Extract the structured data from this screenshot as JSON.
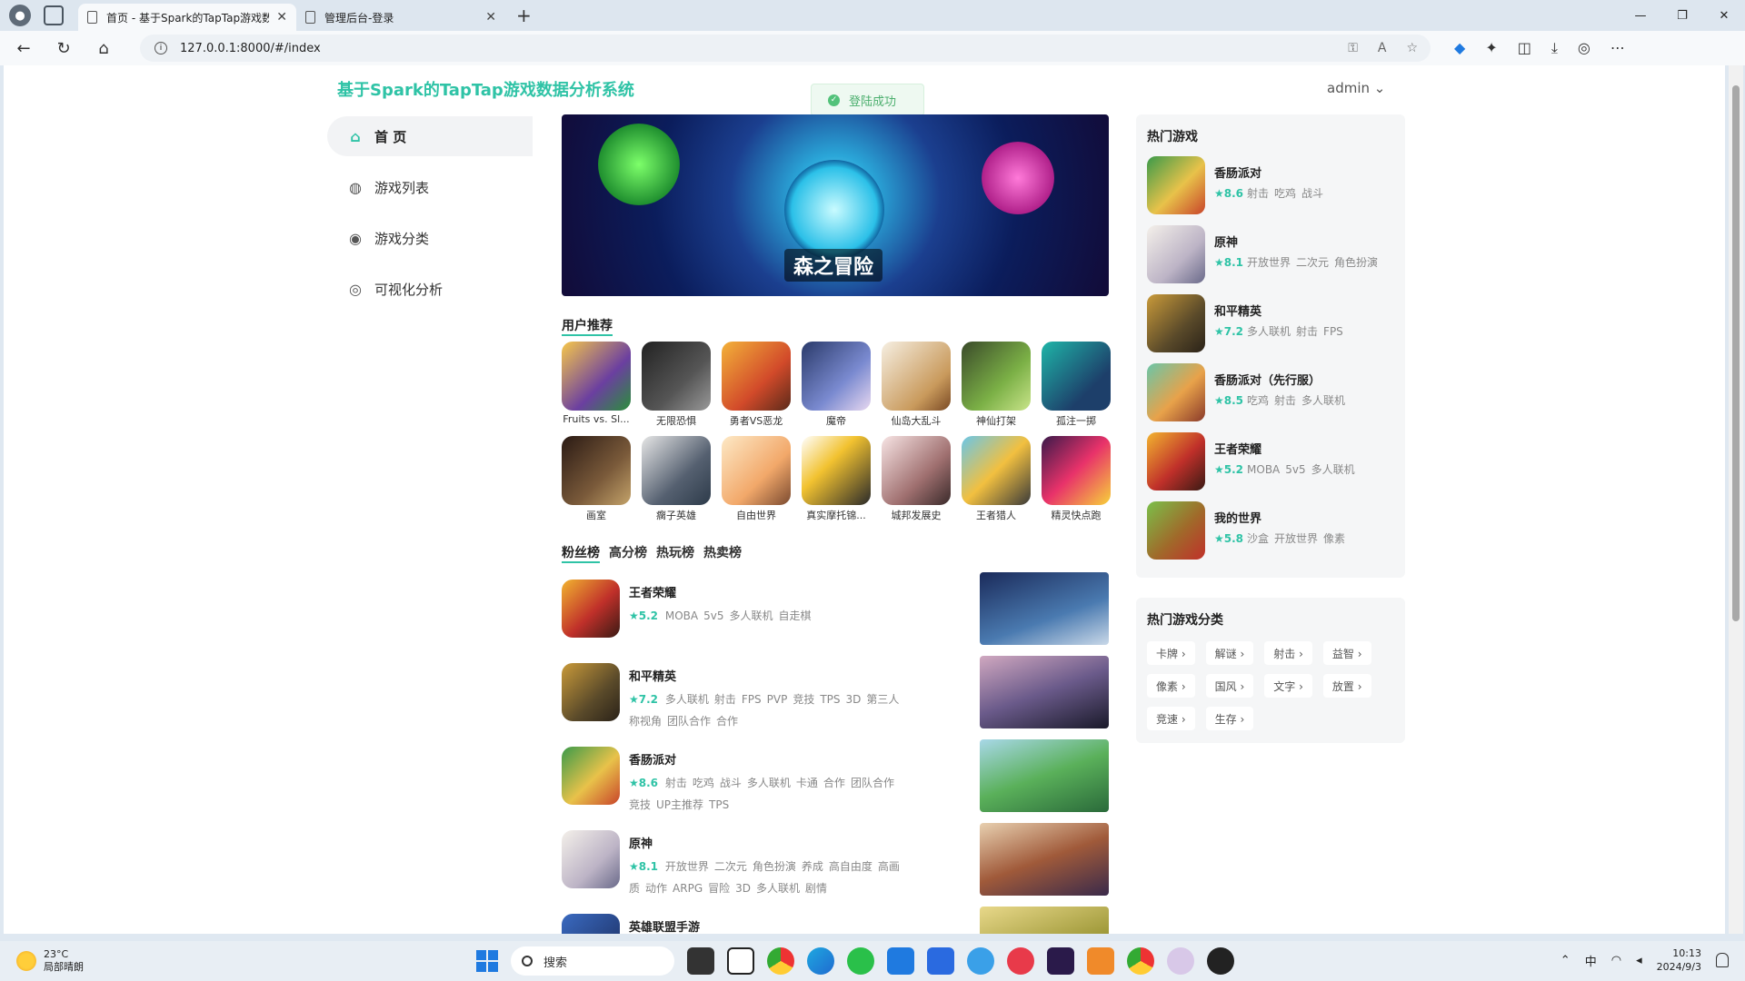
{
  "browser": {
    "tabs": [
      {
        "title": "首页 - 基于Spark的TapTap游戏数",
        "active": true
      },
      {
        "title": "管理后台-登录",
        "active": false
      }
    ],
    "url": "127.0.0.1:8000/#/index"
  },
  "site": {
    "title": "基于Spark的TapTap游戏数据分析系统",
    "user": "admin",
    "toast": "登陆成功"
  },
  "sidebar": {
    "items": [
      {
        "label": "首 页",
        "icon": "home-icon",
        "active": true
      },
      {
        "label": "游戏列表",
        "icon": "planet-icon",
        "active": false
      },
      {
        "label": "游戏分类",
        "icon": "gamepad-icon",
        "active": false
      },
      {
        "label": "可视化分析",
        "icon": "analytics-icon",
        "active": false
      }
    ]
  },
  "banner": {
    "caption": "森之冒险"
  },
  "recommend": {
    "title": "用户推荐",
    "row1": [
      {
        "name": "Fruits vs. Sl..."
      },
      {
        "name": "无限恐惧"
      },
      {
        "name": "勇者VS恶龙"
      },
      {
        "name": "魔帝"
      },
      {
        "name": "仙岛大乱斗"
      },
      {
        "name": "神仙打架"
      },
      {
        "name": "孤注一掷"
      }
    ],
    "row2": [
      {
        "name": "画室"
      },
      {
        "name": "瘸子英雄"
      },
      {
        "name": "自由世界"
      },
      {
        "name": "真实摩托锦..."
      },
      {
        "name": "城邦发展史"
      },
      {
        "name": "王者猎人"
      },
      {
        "name": "精灵快点跑"
      }
    ]
  },
  "rank": {
    "tabs": [
      "粉丝榜",
      "高分榜",
      "热玩榜",
      "热卖榜"
    ],
    "active_tab": "粉丝榜",
    "items": [
      {
        "name": "王者荣耀",
        "score": "★5.2",
        "tags": [
          "MOBA",
          "5v5",
          "多人联机",
          "自走棋"
        ]
      },
      {
        "name": "和平精英",
        "score": "★7.2",
        "tags": [
          "多人联机",
          "射击",
          "FPS",
          "PVP",
          "竞技",
          "TPS",
          "3D",
          "第三人称视角",
          "团队合作",
          "合作"
        ]
      },
      {
        "name": "香肠派对",
        "score": "★8.6",
        "tags": [
          "射击",
          "吃鸡",
          "战斗",
          "多人联机",
          "卡通",
          "合作",
          "团队合作",
          "竞技",
          "UP主推荐",
          "TPS"
        ]
      },
      {
        "name": "原神",
        "score": "★8.1",
        "tags": [
          "开放世界",
          "二次元",
          "角色扮演",
          "养成",
          "高自由度",
          "高画质",
          "动作",
          "ARPG",
          "冒险",
          "3D",
          "多人联机",
          "剧情"
        ]
      },
      {
        "name": "英雄联盟手游",
        "score": "",
        "tags": []
      }
    ]
  },
  "hot_games": {
    "title": "热门游戏",
    "items": [
      {
        "name": "香肠派对",
        "score": "★8.6",
        "tags": [
          "射击",
          "吃鸡",
          "战斗"
        ]
      },
      {
        "name": "原神",
        "score": "★8.1",
        "tags": [
          "开放世界",
          "二次元",
          "角色扮演"
        ]
      },
      {
        "name": "和平精英",
        "score": "★7.2",
        "tags": [
          "多人联机",
          "射击",
          "FPS"
        ]
      },
      {
        "name": "香肠派对（先行服）",
        "score": "★8.5",
        "tags": [
          "吃鸡",
          "射击",
          "多人联机"
        ]
      },
      {
        "name": "王者荣耀",
        "score": "★5.2",
        "tags": [
          "MOBA",
          "5v5",
          "多人联机"
        ]
      },
      {
        "name": "我的世界",
        "score": "★5.8",
        "tags": [
          "沙盒",
          "开放世界",
          "像素"
        ]
      }
    ]
  },
  "hot_categories": {
    "title": "热门游戏分类",
    "items": [
      "卡牌 ›",
      "解谜 ›",
      "射击 ›",
      "益智 ›",
      "像素 ›",
      "国风 ›",
      "文字 ›",
      "放置 ›",
      "竞速 ›",
      "生存 ›"
    ]
  },
  "taskbar": {
    "weather_temp": "23°C",
    "weather_desc": "局部晴朗",
    "search_placeholder": "搜索",
    "ime": "中",
    "time": "10:13",
    "date": "2024/9/3"
  }
}
